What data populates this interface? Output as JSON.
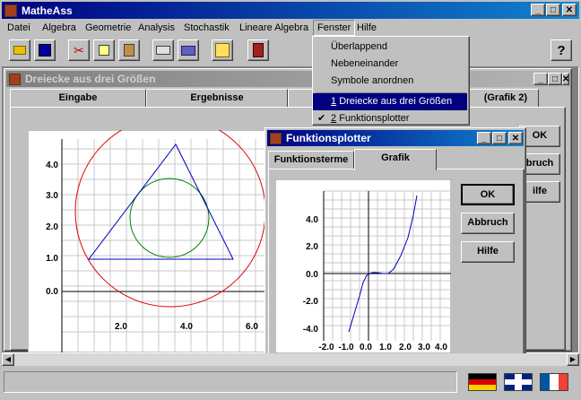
{
  "app": {
    "title": "MatheAss"
  },
  "menu": [
    "Datei",
    "Algebra",
    "Geometrie",
    "Analysis",
    "Stochastik",
    "Lineare Algebra",
    "Fenster",
    "Hilfe"
  ],
  "fenster_menu": {
    "items": [
      "Überlappend",
      "Nebeneinander",
      "Symbole anordnen"
    ],
    "windows": [
      {
        "num": "1",
        "label": "Dreiecke aus drei Größen",
        "checked": false,
        "highlighted": true
      },
      {
        "num": "2",
        "label": "Funktionsplotter",
        "checked": true,
        "highlighted": false
      }
    ]
  },
  "toolbar": {
    "help_symbol": "?"
  },
  "dreiecke_window": {
    "title": "Dreiecke aus drei Größen",
    "tabs": [
      "Eingabe",
      "Ergebnisse",
      "(Grafik 2)"
    ],
    "buttons": {
      "ok": "OK",
      "abbruch": "bruch",
      "hilfe": "ilfe"
    },
    "x_ticks": [
      "2.0",
      "4.0",
      "6.0"
    ],
    "y_ticks": [
      "4.0",
      "3.0",
      "2.0",
      "1.0",
      "0.0"
    ]
  },
  "plotter_window": {
    "title": "Funktionsplotter",
    "tabs": [
      "Funktionsterme",
      "Grafik"
    ],
    "buttons": {
      "ok": "OK",
      "abbruch": "Abbruch",
      "hilfe": "Hilfe"
    },
    "x_ticks": [
      "-2.0",
      "-1.0",
      "0.0",
      "1.0",
      "2.0",
      "3.0",
      "4.0"
    ],
    "y_ticks": [
      "4.0",
      "2.0",
      "0.0",
      "-2.0",
      "-4.0"
    ]
  },
  "colors": {
    "circumcircle": "#e00000",
    "incircle": "#008000",
    "triangle": "#0000c0",
    "function_curve": "#0000c0"
  }
}
